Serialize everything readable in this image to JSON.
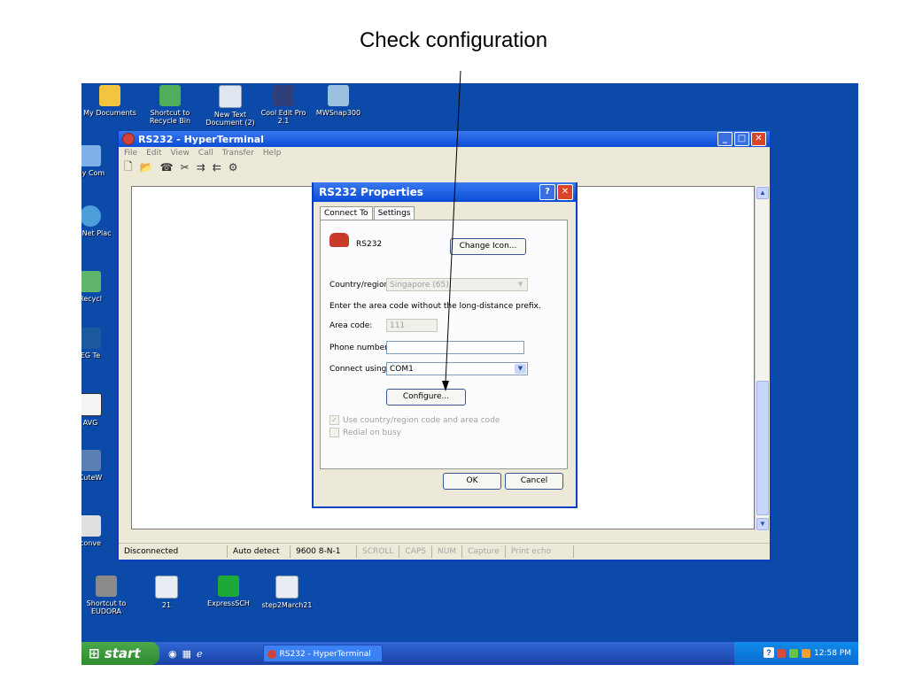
{
  "caption": "Check configuration",
  "desktop": {
    "icons_top": [
      {
        "label": "My Documents",
        "color": "#f2c440"
      },
      {
        "label": "Shortcut to Recycle Bin",
        "color": "#4fae5a"
      },
      {
        "label": "New Text Document (2)",
        "color": "#dfe6ef"
      },
      {
        "label": "Cool Edit Pro 2.1",
        "color": "#2f3f7a"
      },
      {
        "label": "MWSnap300",
        "color": "#9cc0e0"
      }
    ],
    "icons_left": [
      {
        "label": "My Com"
      },
      {
        "label": "My Net Plac"
      },
      {
        "label": "Recycl"
      },
      {
        "label": "EG Te"
      },
      {
        "label": "AVG"
      },
      {
        "label": "CuteW"
      },
      {
        "label": "conve"
      }
    ],
    "icons_bottom": [
      {
        "label": "Shortcut to EUDORA",
        "color": "#8a8a8a"
      },
      {
        "label": "21",
        "color": "#e9edf3"
      },
      {
        "label": "ExpressSCH",
        "color": "#1fa83a"
      },
      {
        "label": "step2March21",
        "color": "#e9edf3"
      }
    ]
  },
  "window": {
    "title": "RS232 - HyperTerminal",
    "menu": [
      "File",
      "Edit",
      "View",
      "Call",
      "Transfer",
      "Help"
    ],
    "toolbar_icons": [
      "new-icon",
      "open-icon",
      "call-icon",
      "disconnect-icon",
      "send-icon",
      "receive-icon",
      "properties-icon"
    ],
    "status": {
      "connection": "Disconnected",
      "detect": "Auto detect",
      "settings": "9600 8-N-1",
      "scroll": "SCROLL",
      "caps": "CAPS",
      "num": "NUM",
      "capture": "Capture",
      "print_echo": "Print echo"
    }
  },
  "dialog": {
    "title": "RS232 Properties",
    "tabs": [
      "Connect To",
      "Settings"
    ],
    "connection_name": "RS232",
    "change_icon_button": "Change Icon...",
    "country_label": "Country/region:",
    "country_value": "Singapore (65)",
    "area_hint": "Enter the area code without the long-distance prefix.",
    "area_label": "Area code:",
    "area_value": "111",
    "phone_label": "Phone number:",
    "phone_value": "",
    "connect_label": "Connect using:",
    "connect_value": "COM1",
    "configure_button": "Configure...",
    "use_country_checkbox": "Use country/region code and area code",
    "redial_checkbox": "Redial on busy",
    "ok_button": "OK",
    "cancel_button": "Cancel"
  },
  "taskbar": {
    "start_label": "start",
    "task_label": "RS232 - HyperTerminal",
    "clock": "12:58 PM"
  }
}
